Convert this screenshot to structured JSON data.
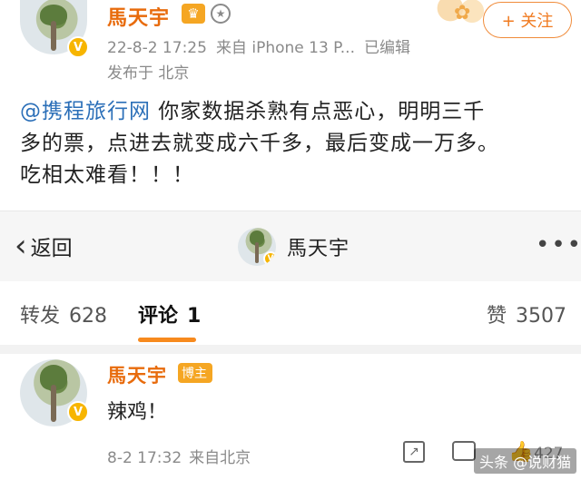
{
  "post": {
    "username": "馬天宇",
    "badge_v": "V",
    "crown_icon": "crown-icon",
    "medal_icon": "medal-icon",
    "datetime": "22-8-2 17:25",
    "source": "来自 iPhone 13 P...",
    "edited": "已编辑",
    "location": "发布于 北京",
    "follow_label": "+ 关注",
    "mention": "@携程旅行网",
    "text_line1_rest": " 你家数据杀熟有点恶心，明明三千",
    "text_line2": "多的票，点进去就变成六千多，最后变成一万多。",
    "text_line3": "吃相太难看！！！"
  },
  "navbar": {
    "back_label": "返回",
    "title": "馬天宇",
    "more_icon": "more-icon"
  },
  "tabs": {
    "repost_label": "转发",
    "repost_count": "628",
    "comment_label": "评论",
    "comment_count": "1",
    "like_label": "赞",
    "like_count": "3507"
  },
  "comment": {
    "username": "馬天宇",
    "badge_v": "V",
    "blogger_badge": "博主",
    "text": "辣鸡！",
    "datetime": "8-2 17:32",
    "source": "来自北京",
    "like_count": "427"
  },
  "watermark": "头条 @说财猫",
  "colors": {
    "username": "#e86b0c",
    "mention": "#2b6fb8",
    "accent": "#f78a1e",
    "meta": "#8a8a8a"
  }
}
